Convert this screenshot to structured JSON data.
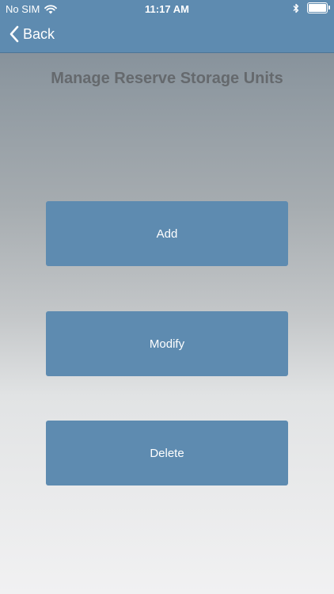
{
  "status_bar": {
    "carrier": "No SIM",
    "time": "11:17 AM",
    "battery_level": 1.0
  },
  "nav": {
    "back_label": "Back"
  },
  "page": {
    "title": "Manage Reserve Storage Units"
  },
  "actions": {
    "add_label": "Add",
    "modify_label": "Modify",
    "delete_label": "Delete"
  },
  "colors": {
    "accent": "#5e8bb0",
    "title_text": "#65696d",
    "button_text": "#ffffff"
  },
  "icons": {
    "wifi": "wifi-icon",
    "bluetooth": "bluetooth-icon",
    "battery": "battery-icon",
    "back": "chevron-left-icon"
  }
}
